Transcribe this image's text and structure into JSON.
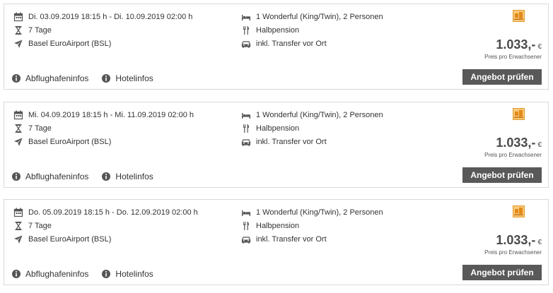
{
  "offers": [
    {
      "dates": "Di. 03.09.2019 18:15 h - Di. 10.09.2019 02:00 h",
      "duration": "7 Tage",
      "airport": "Basel EuroAirport (BSL)",
      "room": "1 Wonderful (King/Twin), 2 Personen",
      "board": "Halbpension",
      "transfer": "inkl. Transfer vor Ort",
      "price": "1.033,-",
      "currency": "€",
      "price_note": "Preis pro Erwachsener",
      "button": "Angebot prüfen",
      "link_airport": "Abflughafeninfos",
      "link_hotel": "Hotelinfos"
    },
    {
      "dates": "Mi. 04.09.2019 18:15 h - Mi. 11.09.2019 02:00 h",
      "duration": "7 Tage",
      "airport": "Basel EuroAirport (BSL)",
      "room": "1 Wonderful (King/Twin), 2 Personen",
      "board": "Halbpension",
      "transfer": "inkl. Transfer vor Ort",
      "price": "1.033,-",
      "currency": "€",
      "price_note": "Preis pro Erwachsener",
      "button": "Angebot prüfen",
      "link_airport": "Abflughafeninfos",
      "link_hotel": "Hotelinfos"
    },
    {
      "dates": "Do. 05.09.2019 18:15 h - Do. 12.09.2019 02:00 h",
      "duration": "7 Tage",
      "airport": "Basel EuroAirport (BSL)",
      "room": "1 Wonderful (King/Twin), 2 Personen",
      "board": "Halbpension",
      "transfer": "inkl. Transfer vor Ort",
      "price": "1.033,-",
      "currency": "€",
      "price_note": "Preis pro Erwachsener",
      "button": "Angebot prüfen",
      "link_airport": "Abflughafeninfos",
      "link_hotel": "Hotelinfos"
    }
  ],
  "icons": {
    "dates": "calendar-icon",
    "duration": "hourglass-icon",
    "airport": "airplane-icon",
    "room": "bed-icon",
    "board": "cutlery-icon",
    "transfer": "car-icon",
    "links": "info-icon",
    "operator": "tour-operator-logo"
  },
  "colors": {
    "button_bg": "#595959",
    "logo": "#f0a030",
    "border": "#d9d9d9"
  }
}
